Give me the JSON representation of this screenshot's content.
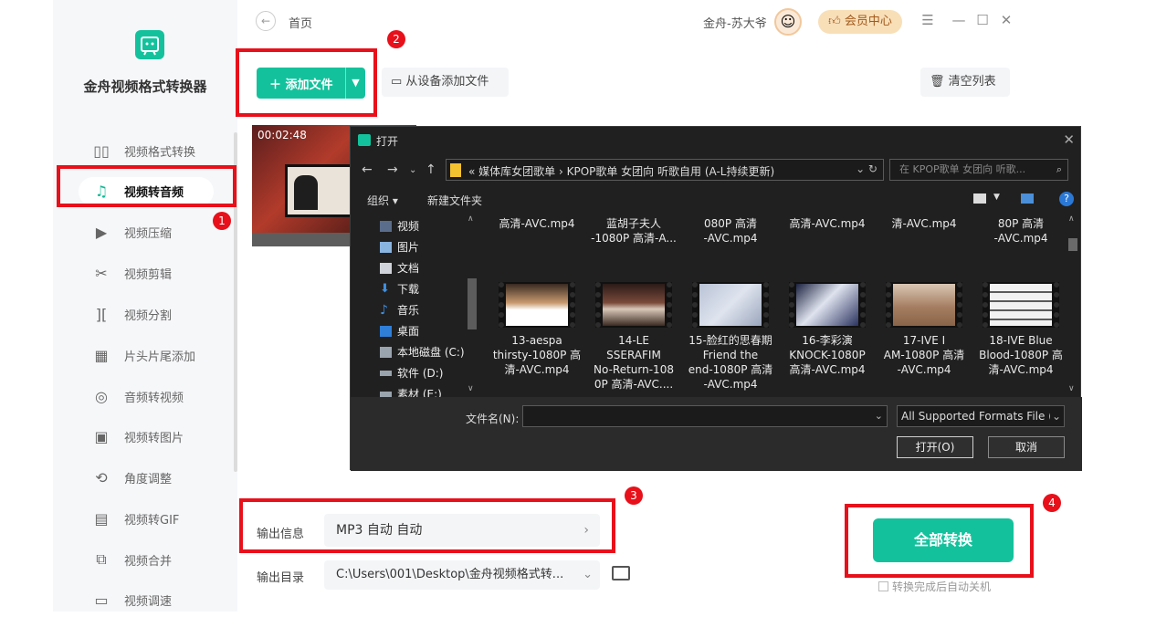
{
  "app": {
    "name": "金舟视频格式转换器"
  },
  "sidebar": {
    "items": [
      {
        "label": "视频格式转换",
        "icon": "format-convert-icon"
      },
      {
        "label": "视频转音频",
        "icon": "music-note-icon",
        "active": true
      },
      {
        "label": "视频压缩",
        "icon": "compress-icon"
      },
      {
        "label": "视频剪辑",
        "icon": "scissors-icon"
      },
      {
        "label": "视频分割",
        "icon": "split-icon"
      },
      {
        "label": "片头片尾添加",
        "icon": "film-icon"
      },
      {
        "label": "音频转视频",
        "icon": "audio-disc-icon"
      },
      {
        "label": "视频转图片",
        "icon": "image-icon"
      },
      {
        "label": "角度调整",
        "icon": "rotate-icon"
      },
      {
        "label": "视频转GIF",
        "icon": "gif-icon"
      },
      {
        "label": "视频合并",
        "icon": "merge-icon"
      },
      {
        "label": "视频调速",
        "icon": "speed-icon"
      }
    ]
  },
  "header": {
    "breadcrumb": "首页",
    "user": "金舟-苏大爷",
    "vip": "会员中心"
  },
  "toolbar": {
    "add_file": "添加文件",
    "add_from_device": "从设备添加文件",
    "clear_list": "清空列表"
  },
  "video": {
    "duration": "00:02:48"
  },
  "output": {
    "info_label": "输出信息",
    "info_value": "MP3  自动  自动",
    "dir_label": "输出目录",
    "dir_value": "C:\\Users\\001\\Desktop\\金舟视频格式转...",
    "convert_all": "全部转换",
    "auto_shutdown": "转换完成后自动关机"
  },
  "annotations": [
    "1",
    "2",
    "3",
    "4"
  ],
  "dialog": {
    "title": "打开",
    "address": "«  媒体库女团歌单  ›  KPOP歌单  女团向  听歌自用 (A-L持续更新)",
    "search_placeholder": "在 KPOP歌单 女团向 听歌...",
    "organize": "组织 ▾",
    "new_folder": "新建文件夹",
    "tree": [
      "视频",
      "图片",
      "文档",
      "下载",
      "音乐",
      "桌面",
      "本地磁盘 (C:)",
      "软件 (D:)",
      "素材 (E:)"
    ],
    "files_row1": [
      "高清-AVC.mp4",
      "蓝胡子夫人\n-1080P 高清-A...",
      "080P 高清\n-AVC.mp4",
      "高清-AVC.mp4",
      "清-AVC.mp4",
      "80P 高清\n-AVC.mp4"
    ],
    "files_row2": [
      "13-aespa\nthirsty-1080P 高\n清-AVC.mp4",
      "14-LE\nSSERAFIM\nNo-Return-108\n0P 高清-AVC....",
      "15-脸红的思春期\nFriend the\nend-1080P 高清\n-AVC.mp4",
      "16-李彩演\nKNOCK-1080P\n高清-AVC.mp4",
      "17-IVE I\nAM-1080P 高清\n-AVC.mp4",
      "18-IVE Blue\nBlood-1080P 高\n清-AVC.mp4"
    ],
    "filename_label": "文件名(N):",
    "format": "All Supported Formats File (",
    "open_btn": "打开(O)",
    "cancel_btn": "取消"
  },
  "colors": {
    "accent": "#13c29c",
    "annotation": "#e8101a"
  }
}
